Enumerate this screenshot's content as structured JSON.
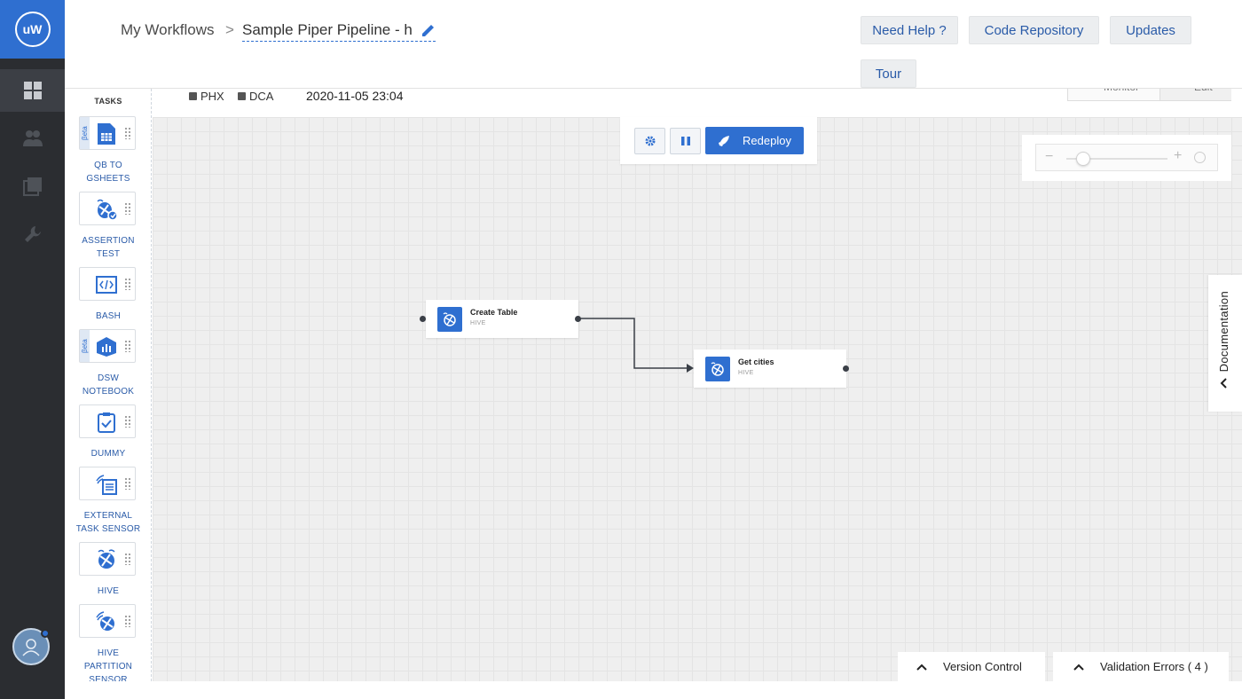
{
  "app": {
    "logo_text": "uW"
  },
  "header": {
    "breadcrumb_root": "My Workflows",
    "breadcrumb_separator": ">",
    "pipeline_name": "Sample Piper Pipeline - h",
    "buttons": {
      "need_help": "Need Help ?",
      "code_repository": "Code Repository",
      "updates": "Updates",
      "tour": "Tour"
    }
  },
  "subheader": {
    "datacenters": [
      "PHX",
      "DCA"
    ],
    "deploy_time": "2020-11-05 23:04",
    "tabs": [
      "Monitor",
      "Edit"
    ]
  },
  "tasks_panel": {
    "title": "TASKS",
    "beta_label": "βeta",
    "items": [
      {
        "label_line1": "QB TO",
        "label_line2": "GSHEETS",
        "icon": "sheets-icon",
        "beta": true
      },
      {
        "label_line1": "ASSERTION",
        "label_line2": "TEST",
        "icon": "assertion-icon",
        "beta": false
      },
      {
        "label_line1": "BASH",
        "label_line2": "",
        "icon": "code-icon",
        "beta": false
      },
      {
        "label_line1": "DSW",
        "label_line2": "NOTEBOOK",
        "icon": "notebook-icon",
        "beta": true
      },
      {
        "label_line1": "DUMMY",
        "label_line2": "",
        "icon": "clipboard-check-icon",
        "beta": false
      },
      {
        "label_line1": "EXTERNAL",
        "label_line2": "TASK SENSOR",
        "icon": "sensor-icon",
        "beta": false
      },
      {
        "label_line1": "HIVE",
        "label_line2": "",
        "icon": "hive-icon",
        "beta": false
      },
      {
        "label_line1": "HIVE",
        "label_line2": "PARTITION",
        "label_line3": "SENSOR",
        "icon": "hive-sensor-icon",
        "beta": false
      }
    ]
  },
  "toolbar": {
    "redeploy_label": "Redeploy"
  },
  "nodes": [
    {
      "title": "Create Table",
      "type": "HIVE"
    },
    {
      "title": "Get cities",
      "type": "HIVE"
    }
  ],
  "zoom": {
    "level": 0.1
  },
  "documentation_tab": {
    "label": "Documentation"
  },
  "bottom_bars": {
    "version_control": "Version Control",
    "validation_errors": "Validation Errors ( 4 )"
  },
  "colors": {
    "accent": "#2f6fd0",
    "rail": "#2b2d31",
    "link": "#2a5ba8"
  }
}
